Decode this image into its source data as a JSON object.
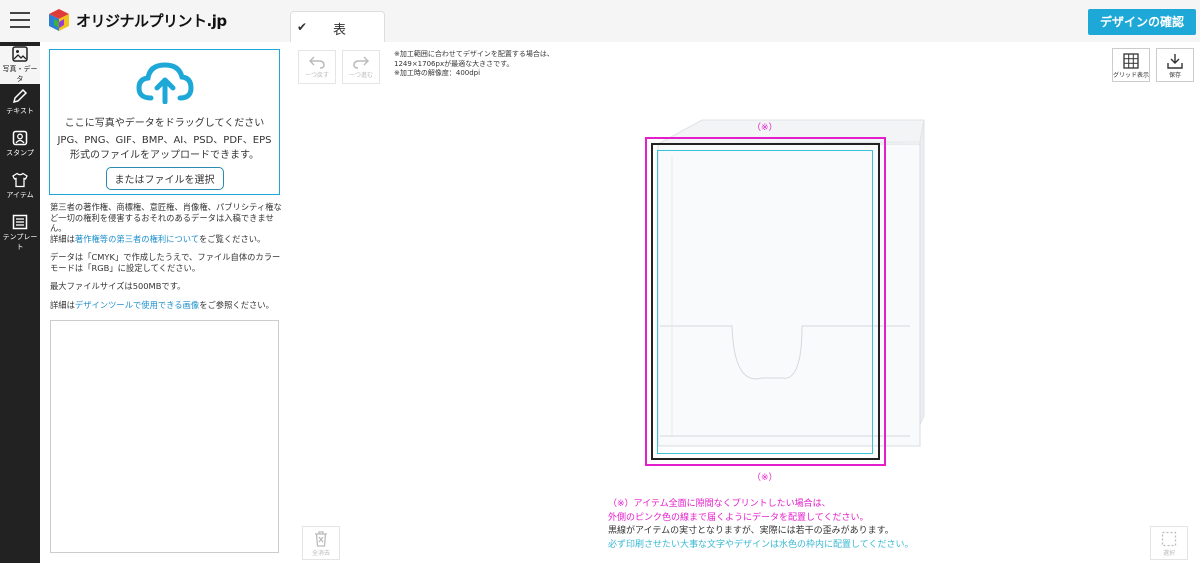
{
  "header": {
    "logo_text": "オリジナルプリント.jp",
    "confirm_label": "デザインの確認",
    "side_tab_label": "表",
    "accent": "#1ea8d8"
  },
  "sidenav": {
    "items": [
      {
        "label": "写真・データ",
        "icon": "image-icon"
      },
      {
        "label": "テキスト",
        "icon": "pencil-icon"
      },
      {
        "label": "スタンプ",
        "icon": "stamp-icon"
      },
      {
        "label": "アイテム",
        "icon": "tshirt-icon"
      },
      {
        "label": "テンプレート",
        "icon": "template-icon"
      }
    ]
  },
  "upload": {
    "drag_text": "ここに写真やデータをドラッグしてください",
    "formats_line1": "JPG、PNG、GIF、BMP、AI、PSD、PDF、EPS",
    "formats_line2": "形式のファイルをアップロードできます。",
    "select_button": "またはファイルを選択"
  },
  "notes": {
    "p1": "第三者の著作権、商標権、意匠権、肖像権、パブリシティ権など一切の権利を侵害するおそれのあるデータは入稿できません。",
    "p1b_prefix": "詳細は",
    "p1b_link": "著作権等の第三者の権利について",
    "p1b_suffix": "をご覧ください。",
    "p2": "データは「CMYK」で作成したうえで、ファイル自体のカラーモードは「RGB」に設定してください。",
    "p3": "最大ファイルサイズは500MBです。",
    "p4_prefix": "詳細は",
    "p4_link": "デザインツールで使用できる画像",
    "p4_suffix": "をご参照ください。"
  },
  "toolbar": {
    "undo_label": "一つ戻す",
    "redo_label": "一つ進む",
    "grid_label": "グリッド表示",
    "save_label": "保存",
    "clear_label": "全消去",
    "select_label": "選択"
  },
  "canvas": {
    "dims_line1": "※加工範囲に合わせてデザインを配置する場合は、",
    "dims_line2": "1249×1706pxが最適な大きさです。",
    "dims_line3": "※加工時の解像度：400dpi",
    "mark_top": "（※）",
    "mark_bottom": "（※）"
  },
  "notice": {
    "line1": "（※）アイテム全面に隙間なくプリントしたい場合は、",
    "line2": "外側のピンク色の線まで届くようにデータを配置してください。",
    "line3": "黒線がアイテムの実寸となりますが、実際には若干の歪みがあります。",
    "line4": "必ず印刷させたい大事な文字やデザインは水色の枠内に配置してください。",
    "colors": {
      "pink": "#e51ecc",
      "black": "#333333",
      "cyan": "#39b8d2"
    }
  }
}
